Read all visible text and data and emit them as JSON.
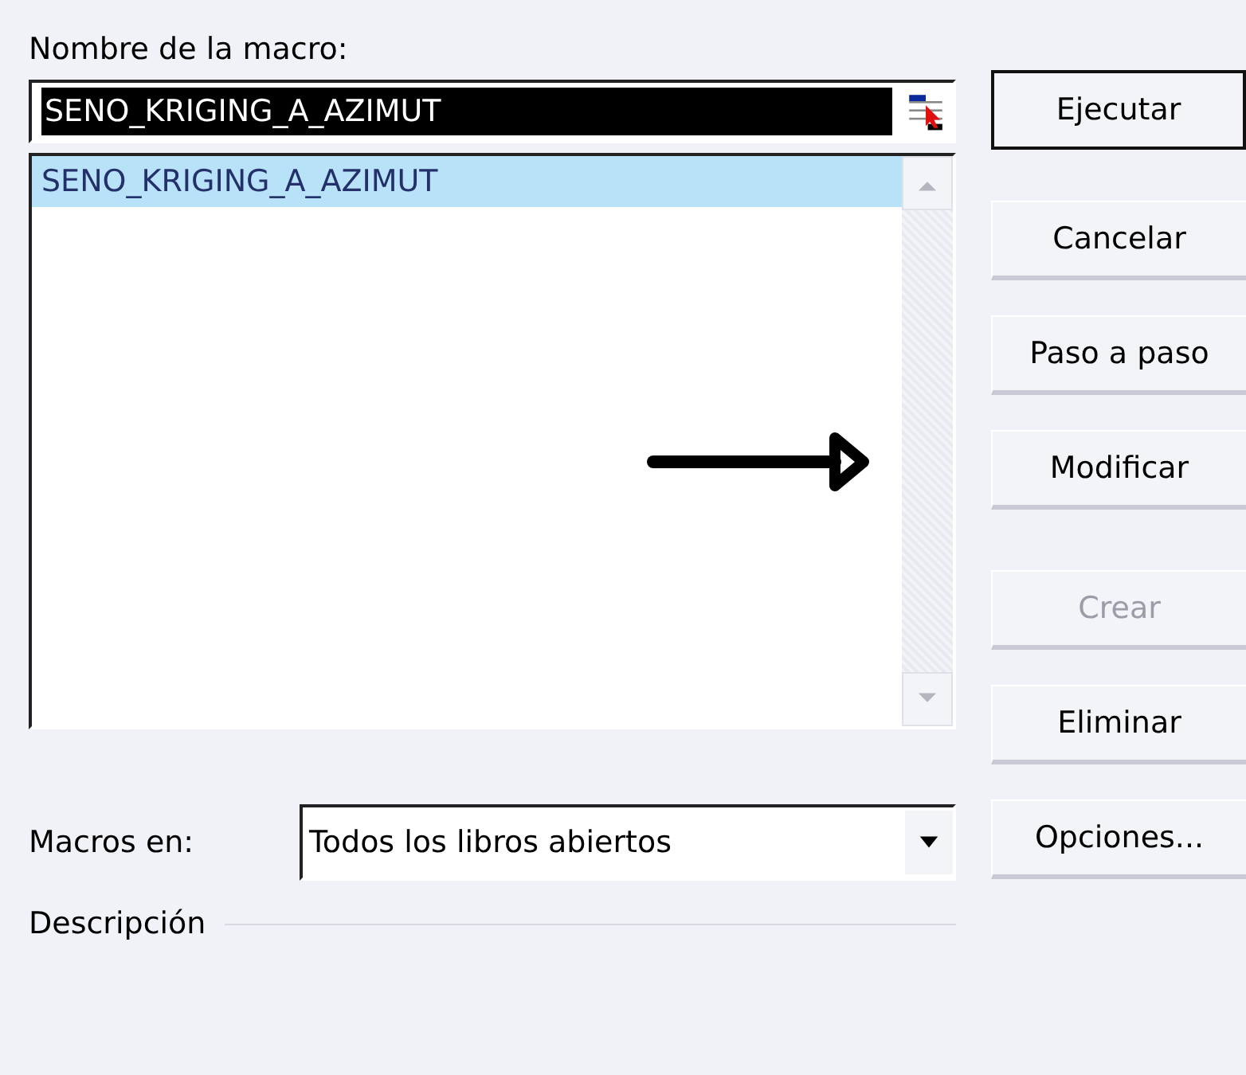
{
  "macro_name": {
    "label": "Nombre de la macro:",
    "value": "SENO_KRIGING_A_AZIMUT",
    "selected": true
  },
  "macro_list": {
    "items": [
      {
        "label": "SENO_KRIGING_A_AZIMUT",
        "selected": true
      }
    ]
  },
  "buttons": [
    {
      "label": "Ejecutar",
      "default": true,
      "disabled": false
    },
    {
      "label": "Cancelar",
      "default": false,
      "disabled": false
    },
    {
      "label": "Paso a paso",
      "default": false,
      "disabled": false
    },
    {
      "label": "Modificar",
      "default": false,
      "disabled": false
    },
    {
      "label": "Crear",
      "default": false,
      "disabled": true
    },
    {
      "label": "Eliminar",
      "default": false,
      "disabled": false
    },
    {
      "label": "Opciones...",
      "default": false,
      "disabled": false
    }
  ],
  "macros_in": {
    "label": "Macros en:",
    "value": "Todos los libros abiertos"
  },
  "description": {
    "label": "Descripción"
  }
}
